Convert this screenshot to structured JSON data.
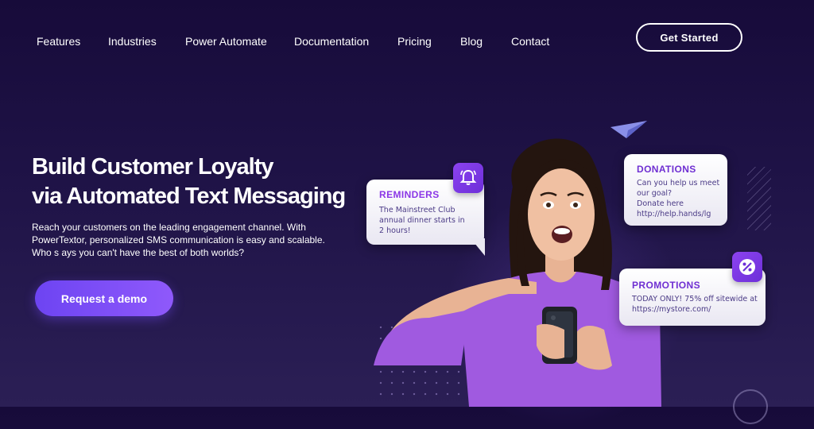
{
  "nav": {
    "links": [
      "Features",
      "Industries",
      "Power Automate",
      "Documentation",
      "Pricing",
      "Blog",
      "Contact"
    ],
    "cta_label": "Get Started"
  },
  "hero": {
    "title_line1": "Build Customer Loyalty",
    "title_line2": "via Automated Text Messaging",
    "subtitle": "Reach your customers on the leading engagement channel. With PowerTextor, personalized SMS communication is easy and scalable. Who s ays you can't have the best of both worlds?",
    "demo_label": "Request a demo"
  },
  "cards": {
    "reminders": {
      "title": "REMINDERS",
      "body": "The Mainstreet Club\nannual dinner starts in\n2 hours!",
      "icon": "bell-icon"
    },
    "donations": {
      "title": "DONATIONS",
      "body": "Can you help us meet\nour goal?\nDonate here\nhttp://help.hands/lg"
    },
    "promotions": {
      "title": "PROMOTIONS",
      "body": "TODAY ONLY! 75% off sitewide at\nhttps://mystore.com/",
      "icon": "percent-icon"
    }
  },
  "colors": {
    "background": "#1b0f40",
    "accent": "#7b4cf5",
    "card_title": "#8a36e6"
  }
}
